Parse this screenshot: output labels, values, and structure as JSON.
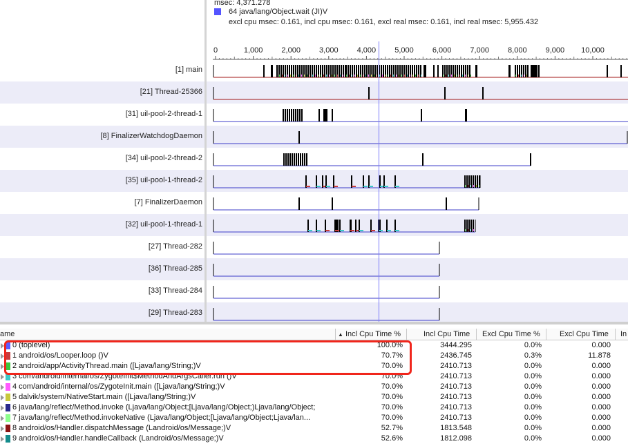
{
  "header": {
    "msec_line": "msec: 4,371.278",
    "method_line": "64 java/lang/Object.wait (JI)V",
    "swatch_color": "#5454ff",
    "stats_line": "excl cpu msec: 0.161, incl cpu msec: 0.161, excl real msec: 0.161, incl real msec: 5,955.432"
  },
  "ruler": {
    "ticks": [
      "0",
      "1,000",
      "2,000",
      "3,000",
      "4,000",
      "5,000",
      "6,000",
      "7,000",
      "8,000",
      "9,000",
      "10,000"
    ]
  },
  "threads": [
    {
      "label": "[1] main"
    },
    {
      "label": "[21] Thread-25366"
    },
    {
      "label": "[31] uil-pool-2-thread-1"
    },
    {
      "label": "[8] FinalizerWatchdogDaemon"
    },
    {
      "label": "[34] uil-pool-2-thread-2"
    },
    {
      "label": "[35] uil-pool-1-thread-2"
    },
    {
      "label": "[7] FinalizerDaemon"
    },
    {
      "label": "[32] uil-pool-1-thread-1"
    },
    {
      "label": "[27] Thread-282"
    },
    {
      "label": "[36] Thread-285"
    },
    {
      "label": "[33] Thread-284"
    },
    {
      "label": "[29] Thread-283"
    }
  ],
  "table": {
    "columns": {
      "name": "ame",
      "incl_cpu_pct": "Incl Cpu Time %",
      "incl_cpu": "Incl Cpu Time",
      "excl_cpu_pct": "Excl Cpu Time %",
      "excl_cpu": "Excl Cpu Time",
      "extra": "In"
    },
    "sort_arrow": "▲",
    "rows": [
      {
        "color": "#5b5bff",
        "name": "0 (toplevel)",
        "incl_pct": "100.0%",
        "incl": "3444.295",
        "excl_pct": "0.0%",
        "excl": "0.000"
      },
      {
        "color": "#c83c3c",
        "name": "1 android/os/Looper.loop ()V",
        "incl_pct": "70.7%",
        "incl": "2436.745",
        "excl_pct": "0.3%",
        "excl": "11.878"
      },
      {
        "color": "#3cc83c",
        "name": "2 android/app/ActivityThread.main ([Ljava/lang/String;)V",
        "incl_pct": "70.0%",
        "incl": "2410.713",
        "excl_pct": "0.0%",
        "excl": "0.000"
      },
      {
        "color": "#3cc8c8",
        "name": "3 com/android/internal/os/ZygoteInit$MethodAndArgsCaller.run ()V",
        "incl_pct": "70.0%",
        "incl": "2410.713",
        "excl_pct": "0.0%",
        "excl": "0.000"
      },
      {
        "color": "#ff5aff",
        "name": "4 com/android/internal/os/ZygoteInit.main ([Ljava/lang/String;)V",
        "incl_pct": "70.0%",
        "incl": "2410.713",
        "excl_pct": "0.0%",
        "excl": "0.000"
      },
      {
        "color": "#c8c83c",
        "name": "5 dalvik/system/NativeStart.main ([Ljava/lang/String;)V",
        "incl_pct": "70.0%",
        "incl": "2410.713",
        "excl_pct": "0.0%",
        "excl": "0.000"
      },
      {
        "color": "#28288c",
        "name": "6 java/lang/reflect/Method.invoke (Ljava/lang/Object;[Ljava/lang/Object;)Ljava/lang/Object;",
        "incl_pct": "70.0%",
        "incl": "2410.713",
        "excl_pct": "0.0%",
        "excl": "0.000"
      },
      {
        "color": "#8cff8c",
        "name": "7 java/lang/reflect/Method.invokeNative (Ljava/lang/Object;[Ljava/lang/Object;Ljava/lan...",
        "incl_pct": "70.0%",
        "incl": "2410.713",
        "excl_pct": "0.0%",
        "excl": "0.000"
      },
      {
        "color": "#8c1414",
        "name": "8 android/os/Handler.dispatchMessage (Landroid/os/Message;)V",
        "incl_pct": "52.7%",
        "incl": "1813.548",
        "excl_pct": "0.0%",
        "excl": "0.000"
      },
      {
        "color": "#148c8c",
        "name": "9 android/os/Handler.handleCallback (Landroid/os/Message;)V",
        "incl_pct": "52.6%",
        "incl": "1812.098",
        "excl_pct": "0.0%",
        "excl": "0.000"
      }
    ]
  }
}
